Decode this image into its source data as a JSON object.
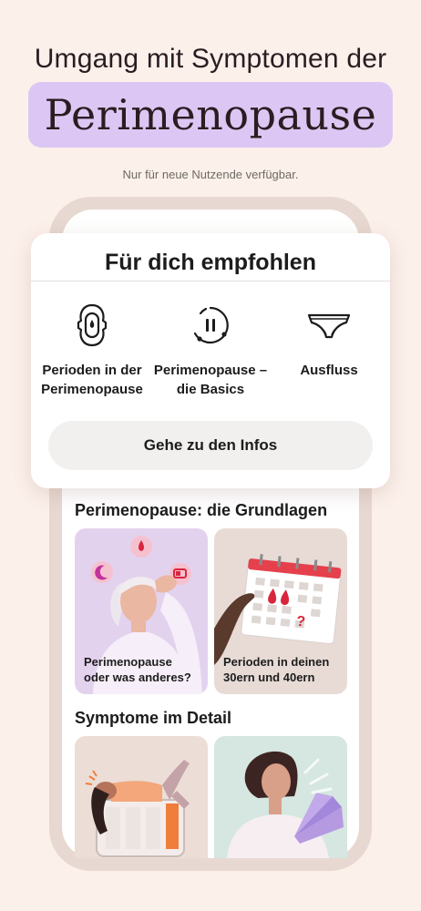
{
  "headline": "Umgang mit Symptomen der",
  "highlight": "Perimenopause",
  "note": "Nur für neue Nutzende verfügbar.",
  "card": {
    "title": "Für dich empfohlen",
    "topics": [
      {
        "label": "Perioden in der Perimenopause",
        "icon": "pad-icon"
      },
      {
        "label": "Perimenopause – die Basics",
        "icon": "cycle-pause-icon"
      },
      {
        "label": "Ausfluss",
        "icon": "underwear-icon"
      }
    ],
    "button": "Gehe zu den Infos"
  },
  "sections": [
    {
      "title": "Perimenopause: die Grundlagen",
      "tiles": [
        {
          "caption": "Perimenopause oder was anderes?",
          "bg": "#e3d2ee"
        },
        {
          "caption": "Perioden in deinen 30ern und 40ern",
          "bg": "#e8dbd6"
        }
      ]
    },
    {
      "title": "Symptome im Detail",
      "tiles": [
        {
          "caption": "",
          "bg": "#ecddd6"
        },
        {
          "caption": "",
          "bg": "#d6e6e0"
        }
      ]
    }
  ],
  "colors": {
    "background": "#fcf0ea",
    "highlight": "#dcc7f4",
    "accent": "#d9263d"
  }
}
